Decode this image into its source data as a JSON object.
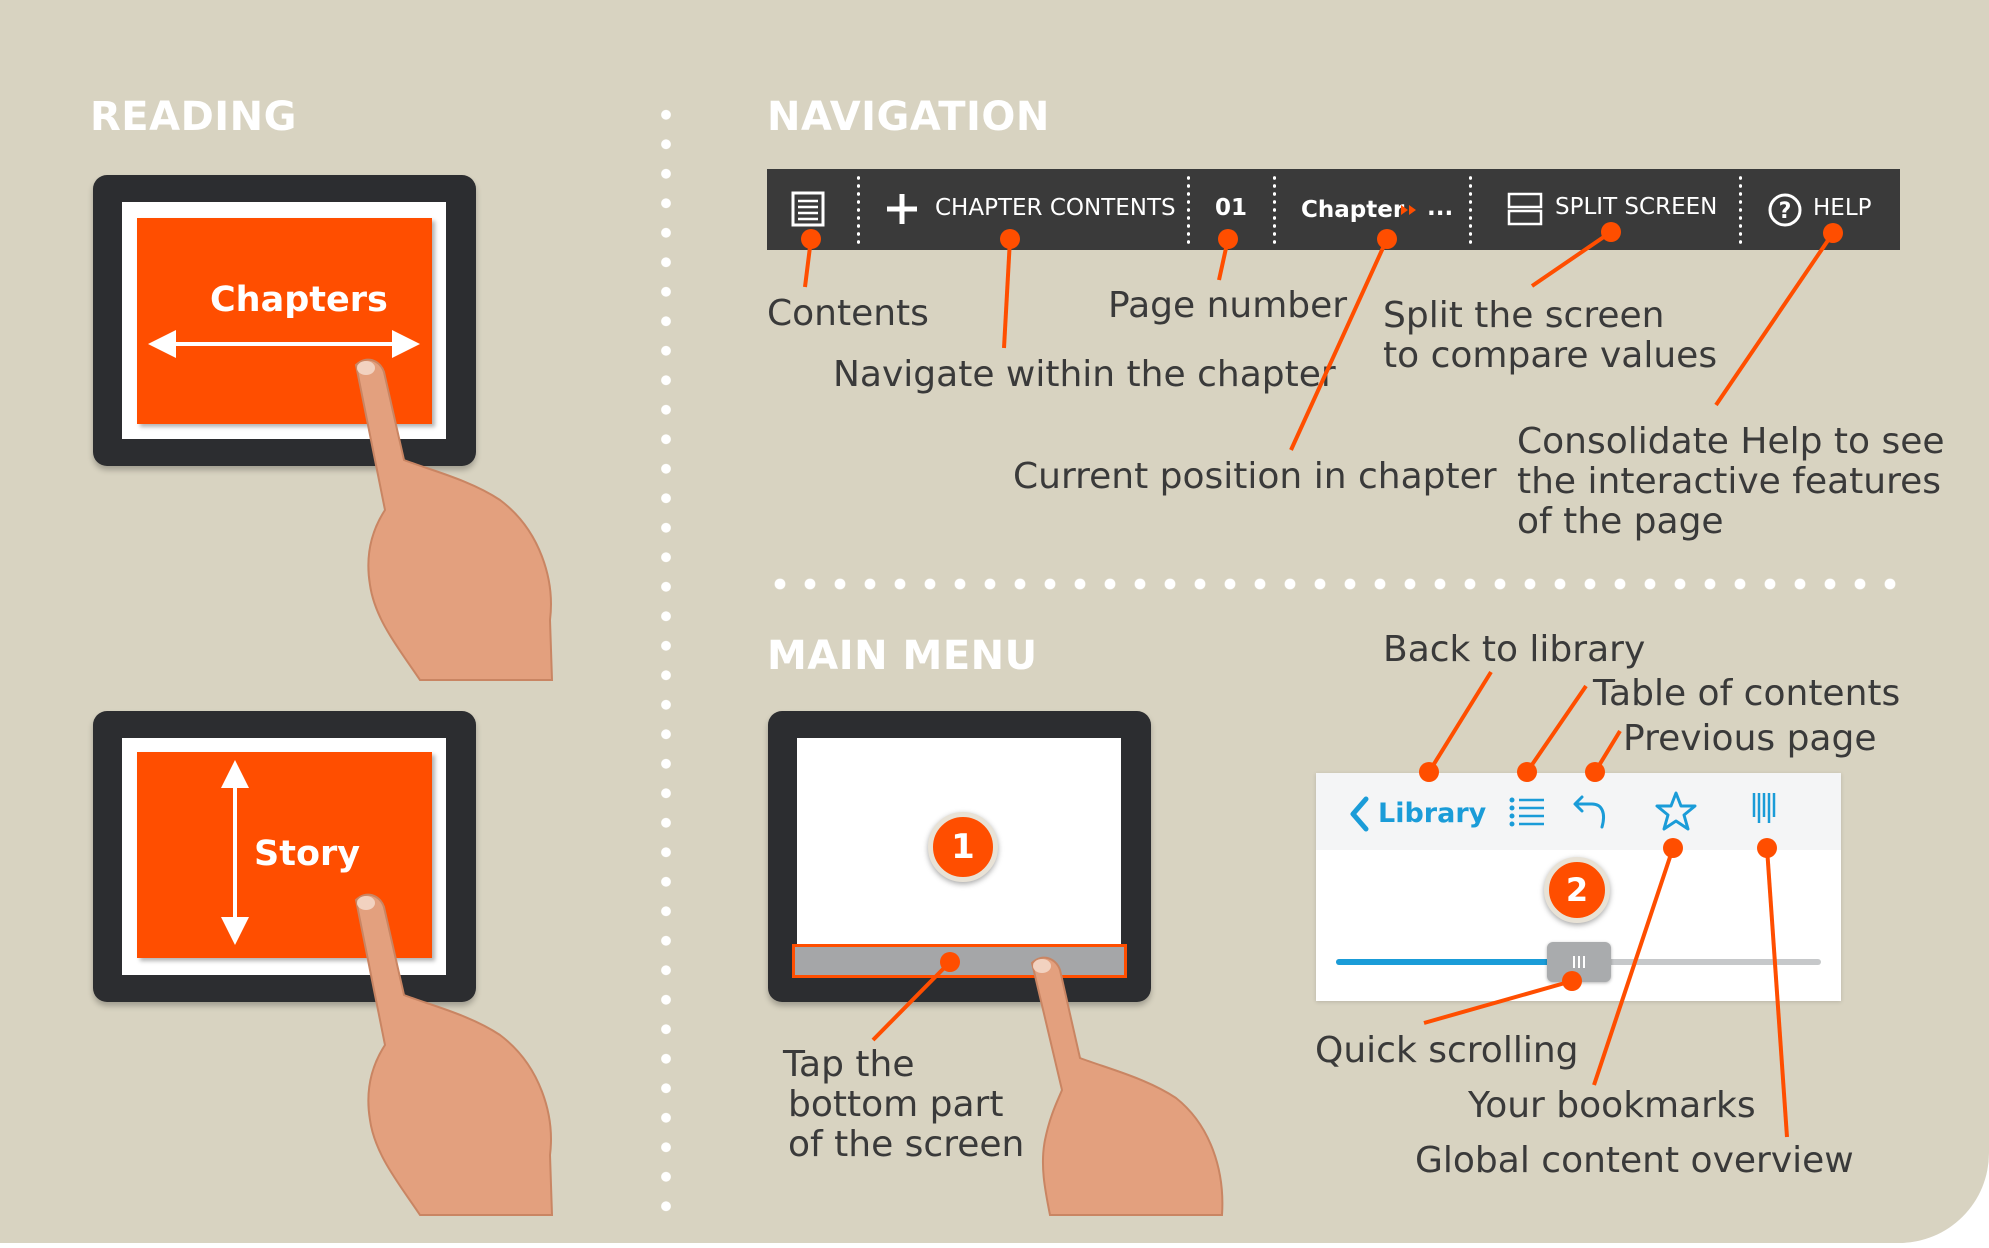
{
  "colors": {
    "background": "#d8d3c1",
    "accent": "#ff4e00",
    "toolbar": "#3a3a3a",
    "ios_blue": "#1a9cd8"
  },
  "sections": {
    "reading": "READING",
    "navigation": "NAVIGATION",
    "main_menu": "MAIN MENU"
  },
  "reading": {
    "chapters_label": "Chapters",
    "story_label": "Story"
  },
  "toolbar": {
    "chapter_contents": "CHAPTER CONTENTS",
    "page_number": "01",
    "chapter": "Chapter",
    "chapter_ellipsis": "...",
    "split_screen": "SPLIT SCREEN",
    "help": "HELP",
    "icons": [
      "list-icon",
      "plus-icon",
      "fast-forward-icon",
      "split-screen-icon",
      "help-icon"
    ]
  },
  "navigation_callouts": {
    "contents": "Contents",
    "navigate_chapter": "Navigate within the chapter",
    "page_number": "Page number",
    "current_position": "Current position in chapter",
    "split_line1": "Split the screen",
    "split_line2": "to compare values",
    "help_line1": "Consolidate Help to see",
    "help_line2": "the interactive features",
    "help_line3": "of the page"
  },
  "main_menu": {
    "step1": "1",
    "step2": "2",
    "tap_line1": "Tap the",
    "tap_line2": "bottom part",
    "tap_line3": "of the screen",
    "library_button": "Library",
    "scroll_position": 0.46,
    "icons": [
      "chevron-left-icon",
      "list-icon",
      "undo-icon",
      "star-icon",
      "barcode-icon"
    ]
  },
  "menu_callouts": {
    "back_to_library": "Back to library",
    "table_of_contents": "Table of contents",
    "previous_page": "Previous page",
    "quick_scrolling": "Quick scrolling",
    "your_bookmarks": "Your bookmarks",
    "global_overview": "Global content overview"
  }
}
